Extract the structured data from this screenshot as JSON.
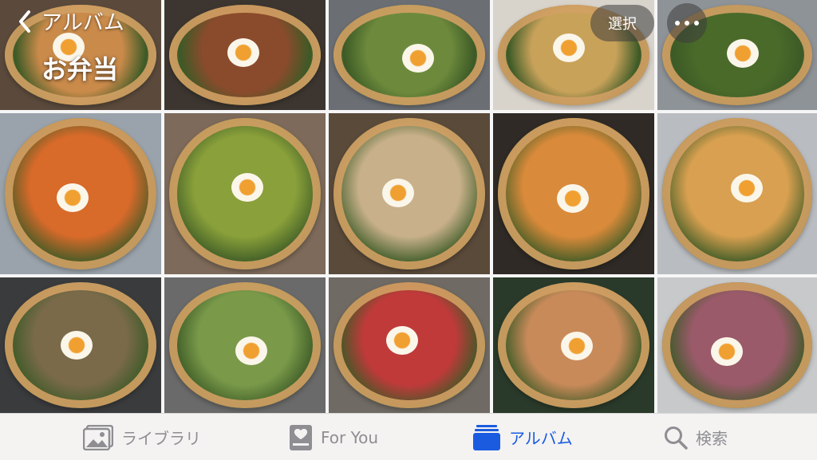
{
  "header": {
    "back_label": "アルバム",
    "album_title": "お弁当",
    "select_label": "選択"
  },
  "colors": {
    "active_tab": "#1a5be0",
    "inactive_tab": "#8e8e93",
    "tabbar_bg": "#f4f3f2"
  },
  "photos": [
    {
      "name": "photo-bento-1",
      "bg": "#5b4a3c",
      "food": "#c98a4a"
    },
    {
      "name": "photo-bento-2",
      "bg": "#3d3630",
      "food": "#8a4b2c"
    },
    {
      "name": "photo-bento-3",
      "bg": "#6b6f74",
      "food": "#6d8a3c"
    },
    {
      "name": "photo-bento-4",
      "bg": "#d8d3cb",
      "food": "#c9a25a"
    },
    {
      "name": "photo-bento-5",
      "bg": "#8e9398",
      "food": "#4a6a2a"
    },
    {
      "name": "photo-bento-6",
      "bg": "#9aa3ab",
      "food": "#d86a2a"
    },
    {
      "name": "photo-bento-7",
      "bg": "#7d6a5a",
      "food": "#8aa03a"
    },
    {
      "name": "photo-bento-8",
      "bg": "#5a4a3a",
      "food": "#c8b08a"
    },
    {
      "name": "photo-bento-9",
      "bg": "#2f2a25",
      "food": "#d98a3a"
    },
    {
      "name": "photo-bento-10",
      "bg": "#b9bcc0",
      "food": "#d8a050"
    },
    {
      "name": "photo-bento-11",
      "bg": "#3a3b3d",
      "food": "#7a6a4a"
    },
    {
      "name": "photo-bento-12",
      "bg": "#6a6a6a",
      "food": "#7a9a4a"
    },
    {
      "name": "photo-bento-13",
      "bg": "#6f6a63",
      "food": "#c03a3a"
    },
    {
      "name": "photo-bento-14",
      "bg": "#2a3a2a",
      "food": "#c98a5a"
    },
    {
      "name": "photo-bento-15",
      "bg": "#c8c9cb",
      "food": "#9a5a6a"
    }
  ],
  "tabs": [
    {
      "key": "library",
      "label": "ライブラリ",
      "icon": "photo-library-icon",
      "active": false
    },
    {
      "key": "for_you",
      "label": "For You",
      "icon": "for-you-icon",
      "active": false
    },
    {
      "key": "albums",
      "label": "アルバム",
      "icon": "albums-icon",
      "active": true
    },
    {
      "key": "search",
      "label": "検索",
      "icon": "search-icon",
      "active": false
    }
  ]
}
